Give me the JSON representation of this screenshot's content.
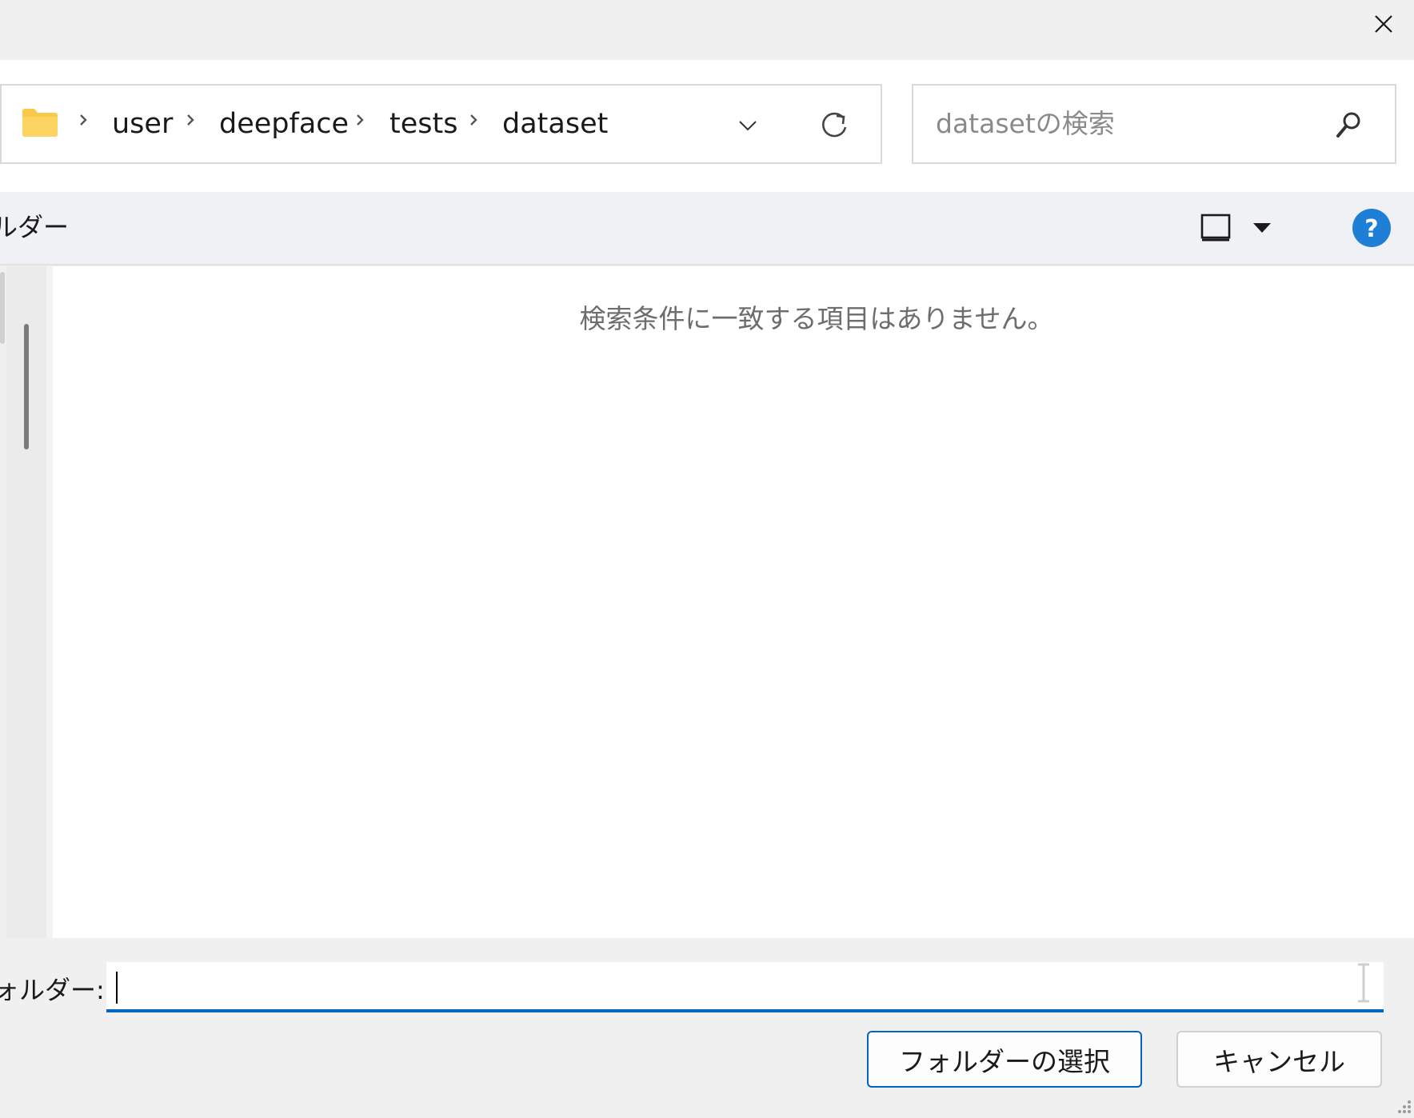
{
  "window": {
    "close_icon": "close-icon"
  },
  "address_bar": {
    "folder_icon": "folder-icon",
    "breadcrumbs": [
      "user",
      "deepface",
      "tests",
      "dataset"
    ],
    "separator_icon": "chevron-right-icon",
    "dropdown_icon": "chevron-down-icon",
    "refresh_icon": "refresh-icon"
  },
  "search": {
    "placeholder": "datasetの検索",
    "icon": "search-icon"
  },
  "toolbar": {
    "label": "ルダー",
    "view_icon": "view-pane-icon",
    "view_dropdown_icon": "caret-down-icon",
    "help_icon": "help-icon"
  },
  "file_list": {
    "empty_message": "検索条件に一致する項目はありません。"
  },
  "footer": {
    "folder_label": "ォルダー:",
    "folder_value": "",
    "select_button": "フォルダーの選択",
    "cancel_button": "キャンセル"
  },
  "colors": {
    "accent": "#0067c0",
    "help_blue": "#1e7fd6",
    "folder_yellow": "#f8c94a",
    "background": "#f0f0f0"
  }
}
